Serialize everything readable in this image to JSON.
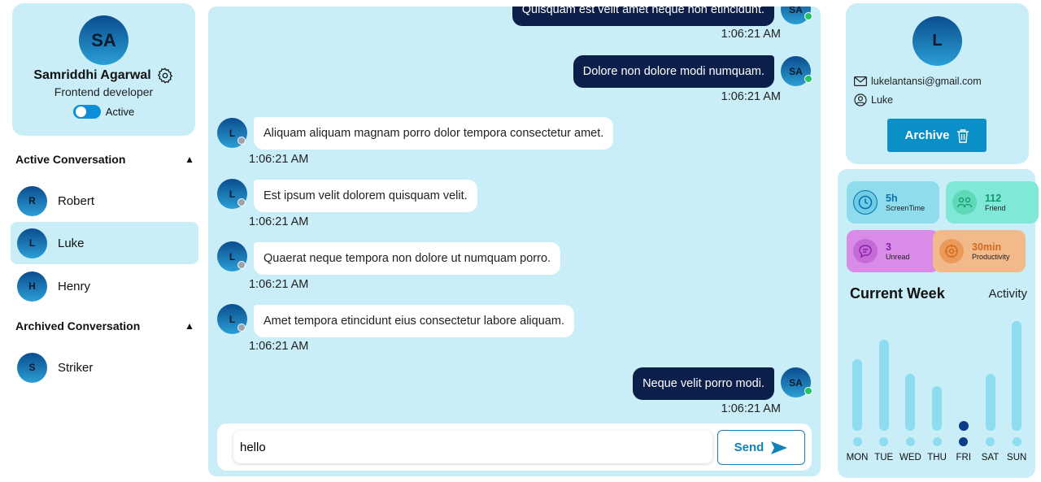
{
  "user": {
    "initials": "SA",
    "name": "Samriddhi Agarwal",
    "role": "Frontend developer",
    "status": "Active"
  },
  "sidebar": {
    "active_title": "Active Conversation",
    "archived_title": "Archived Conversation",
    "active": [
      {
        "initial": "R",
        "name": "Robert"
      },
      {
        "initial": "L",
        "name": "Luke"
      },
      {
        "initial": "H",
        "name": "Henry"
      }
    ],
    "archived": [
      {
        "initial": "S",
        "name": "Striker"
      }
    ]
  },
  "messages": [
    {
      "from": "me",
      "avatar": "SA",
      "text": "Quisquam est velit amet neque non etincidunt.",
      "time": "1:06:21 AM"
    },
    {
      "from": "me",
      "avatar": "SA",
      "text": "Dolore non dolore modi numquam.",
      "time": "1:06:21 AM"
    },
    {
      "from": "them",
      "avatar": "L",
      "text": "Aliquam aliquam magnam porro dolor tempora consectetur amet.",
      "time": "1:06:21 AM"
    },
    {
      "from": "them",
      "avatar": "L",
      "text": "Est ipsum velit dolorem quisquam velit.",
      "time": "1:06:21 AM"
    },
    {
      "from": "them",
      "avatar": "L",
      "text": "Quaerat neque tempora non dolore ut numquam porro.",
      "time": "1:06:21 AM"
    },
    {
      "from": "them",
      "avatar": "L",
      "text": "Amet tempora etincidunt eius consectetur labore aliquam.",
      "time": "1:06:21 AM"
    },
    {
      "from": "me",
      "avatar": "SA",
      "text": "Neque velit porro modi.",
      "time": "1:06:21 AM"
    }
  ],
  "composer": {
    "value": "hello",
    "send_label": "Send"
  },
  "contact": {
    "initial": "L",
    "email": "lukelantansi@gmail.com",
    "username": "Luke",
    "archive_label": "Archive"
  },
  "stats": [
    {
      "value": "5h",
      "label": "ScreenTime",
      "color": "#8fdcef",
      "accent": "#0a6fa8",
      "icon": "clock-icon"
    },
    {
      "value": "112",
      "label": "Friend",
      "color": "#7fe8d6",
      "accent": "#0f9a72",
      "icon": "friends-icon"
    },
    {
      "value": "3",
      "label": "Unread",
      "color": "#d98be8",
      "accent": "#8b1fa8",
      "icon": "chat-icon"
    },
    {
      "value": "30min",
      "label": "Productivity",
      "color": "#f2b98a",
      "accent": "#d2691e",
      "icon": "productivity-icon"
    }
  ],
  "week": {
    "title": "Current Week",
    "link": "Activity",
    "days": [
      "MON",
      "TUE",
      "WED",
      "THU",
      "FRI",
      "SAT",
      "SUN"
    ],
    "levels": [
      0.62,
      0.79,
      0.49,
      0.39,
      0.06,
      0.49,
      0.95
    ],
    "highlight": "FRI",
    "bar_color": "#8ddcef",
    "highlight_color": "#0b3c8a"
  }
}
